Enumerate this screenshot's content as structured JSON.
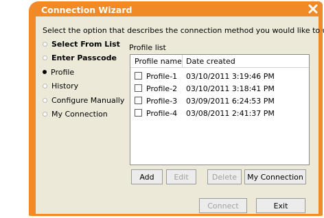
{
  "window": {
    "title": "Connection Wizard",
    "frame_color": "#ef8a26",
    "close_icon": "close-icon"
  },
  "instruction": "Select the option that describes the connection method you would like to use:",
  "options": [
    {
      "label": "Select From List",
      "selected": false,
      "bold": true
    },
    {
      "label": "Enter Passcode",
      "selected": false,
      "bold": true
    },
    {
      "label": "Profile",
      "selected": true,
      "bold": false
    },
    {
      "label": "History",
      "selected": false,
      "bold": false
    },
    {
      "label": "Configure Manually",
      "selected": false,
      "bold": false
    },
    {
      "label": "My Connection",
      "selected": false,
      "bold": false
    }
  ],
  "profile_list": {
    "label": "Profile list",
    "columns": [
      "Profile name",
      "Date created"
    ],
    "rows": [
      {
        "name": "Profile-1",
        "date": "03/10/2011 3:19:46 PM"
      },
      {
        "name": "Profile-2",
        "date": "03/10/2011 3:18:41 PM"
      },
      {
        "name": "Profile-3",
        "date": "03/09/2011 6:24:53 PM"
      },
      {
        "name": "Profile-4",
        "date": "03/08/2011 2:41:37 PM"
      }
    ]
  },
  "list_buttons": {
    "add": "Add",
    "edit": "Edit",
    "delete": "Delete",
    "my_connection": "My Connection"
  },
  "footer_buttons": {
    "connect": "Connect",
    "exit": "Exit"
  }
}
